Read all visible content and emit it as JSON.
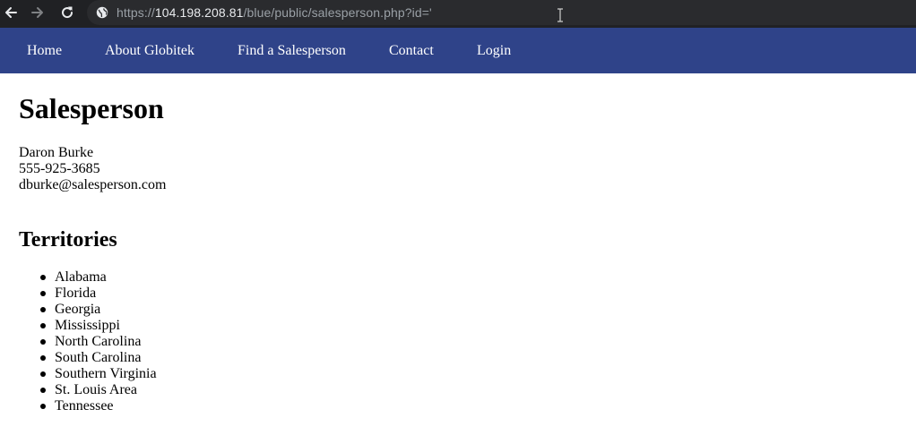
{
  "browser": {
    "url_scheme": "https://",
    "url_host": "104.198.208.81",
    "url_path": "/blue/public/salesperson.php?id='"
  },
  "site_nav": {
    "items": [
      {
        "label": "Home"
      },
      {
        "label": "About Globitek"
      },
      {
        "label": "Find a Salesperson"
      },
      {
        "label": "Contact"
      },
      {
        "label": "Login"
      }
    ]
  },
  "page": {
    "title": "Salesperson",
    "name": "Daron Burke",
    "phone": "555-925-3685",
    "email": "dburke@salesperson.com",
    "territories_heading": "Territories",
    "territories": [
      "Alabama",
      "Florida",
      "Georgia",
      "Mississippi",
      "North Carolina",
      "South Carolina",
      "Southern Virginia",
      "St. Louis Area",
      "Tennessee"
    ]
  },
  "colors": {
    "chrome_bg": "#202124",
    "omnibox_bg": "#2a2b2e",
    "nav_bg": "#2f4389"
  }
}
